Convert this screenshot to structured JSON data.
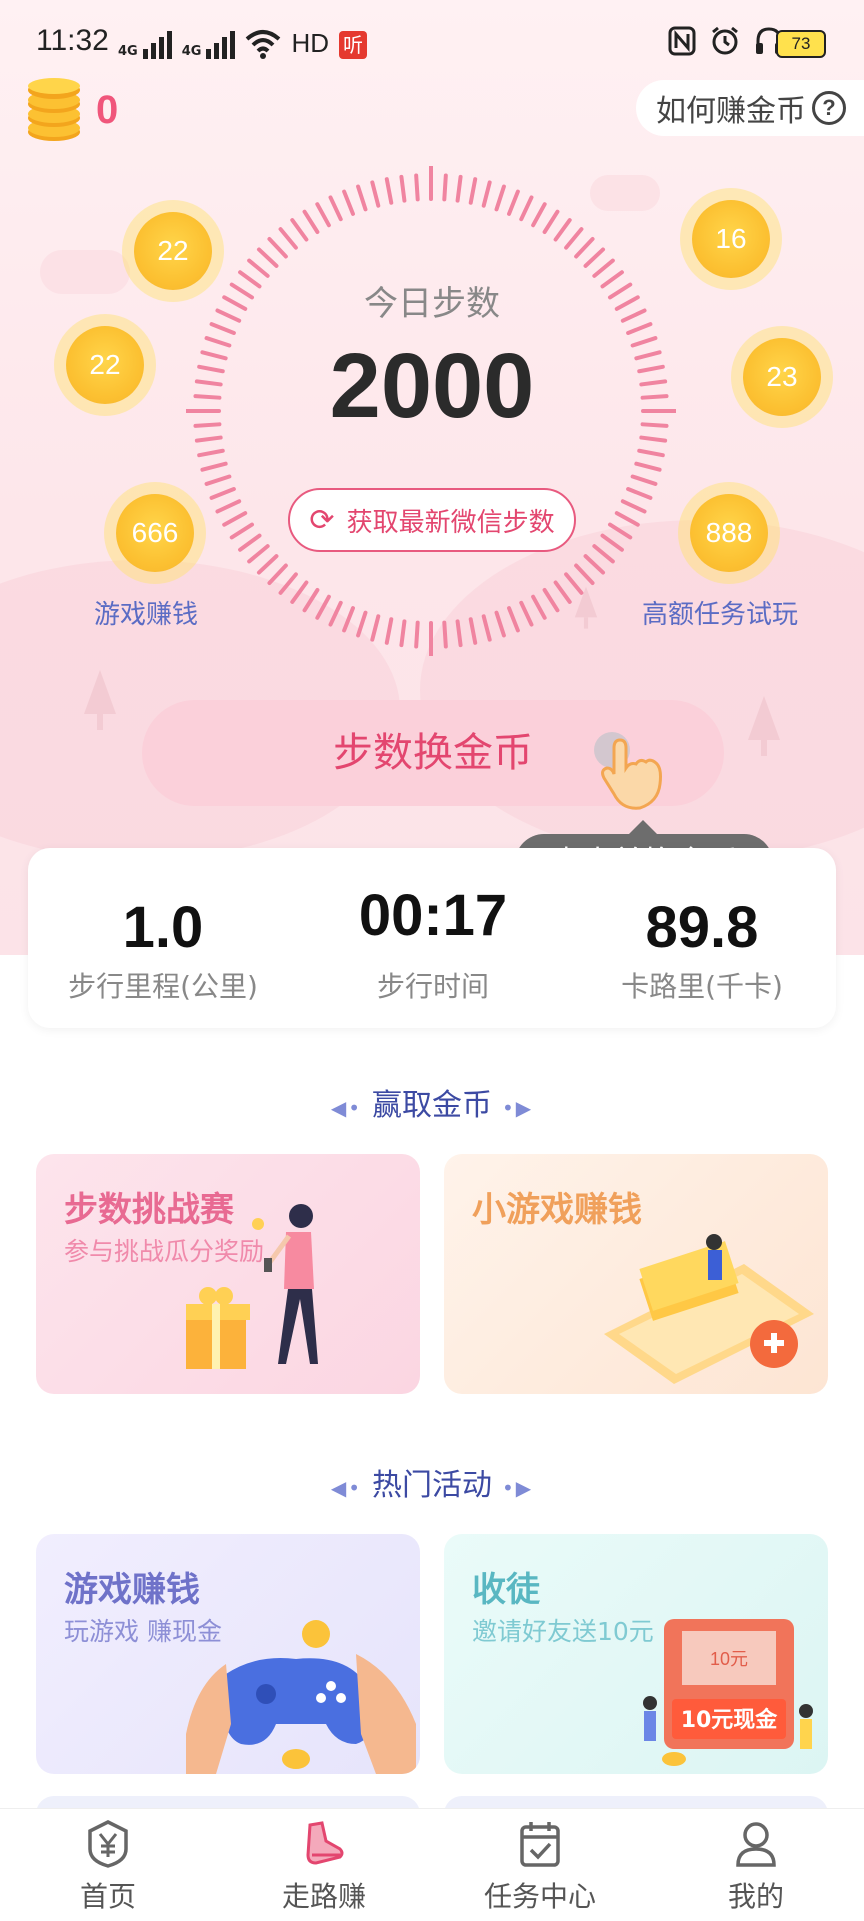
{
  "status_bar": {
    "time": "11:32",
    "network1": "4G",
    "network2": "4G",
    "hd": "HD",
    "app_badge": "听",
    "battery": "73"
  },
  "header": {
    "coin_count": "0",
    "how_to_earn": "如何赚金币"
  },
  "dial": {
    "label": "今日步数",
    "steps": "2000",
    "refresh_button": "获取最新微信步数"
  },
  "bubbles": [
    {
      "value": "22"
    },
    {
      "value": "22"
    },
    {
      "value": "16"
    },
    {
      "value": "23"
    },
    {
      "value": "666",
      "caption": "游戏赚钱"
    },
    {
      "value": "888",
      "caption": "高额任务试玩"
    }
  ],
  "exchange": {
    "button": "步数换金币",
    "tooltip": "点击兑换金币"
  },
  "stats": [
    {
      "value": "1.0",
      "label": "步行里程(公里)"
    },
    {
      "value": "00:17",
      "label": "步行时间"
    },
    {
      "value": "89.8",
      "label": "卡路里(千卡)"
    }
  ],
  "sections": {
    "earn": {
      "title": "赢取金币"
    },
    "hot": {
      "title": "热门活动"
    }
  },
  "earn_cards": [
    {
      "title": "步数挑战赛",
      "subtitle": "参与挑战瓜分奖励"
    },
    {
      "title": "小游戏赚钱"
    }
  ],
  "hot_cards": [
    {
      "title": "游戏赚钱",
      "subtitle": "玩游戏 赚现金"
    },
    {
      "title": "收徒",
      "subtitle": "邀请好友送10元",
      "envelope_small": "10元",
      "envelope_big": "10元现金"
    }
  ],
  "bottom_nav": [
    {
      "label": "首页",
      "icon": "yen-shield-icon"
    },
    {
      "label": "走路赚",
      "icon": "shoe-icon"
    },
    {
      "label": "任务中心",
      "icon": "calendar-check-icon"
    },
    {
      "label": "我的",
      "icon": "person-icon"
    }
  ],
  "colors": {
    "accent": "#e3466f",
    "blue_text": "#5b6cc4",
    "coin": "#fcc132"
  }
}
